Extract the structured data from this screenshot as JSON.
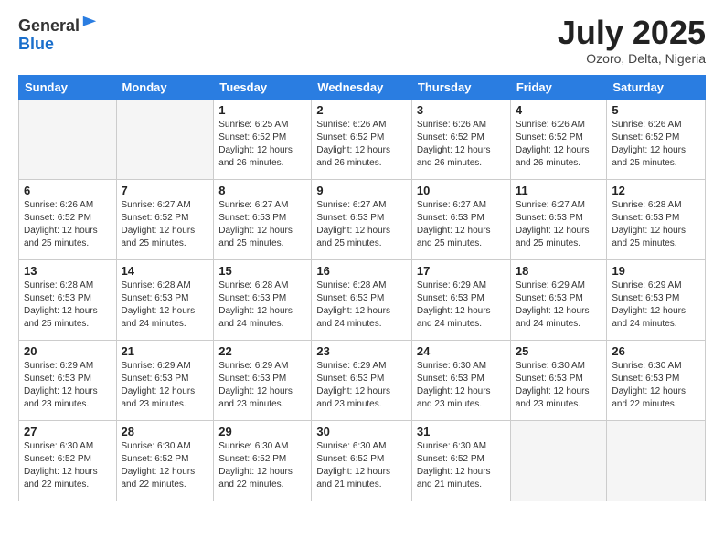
{
  "logo": {
    "general": "General",
    "blue": "Blue"
  },
  "title": "July 2025",
  "location": "Ozoro, Delta, Nigeria",
  "days_of_week": [
    "Sunday",
    "Monday",
    "Tuesday",
    "Wednesday",
    "Thursday",
    "Friday",
    "Saturday"
  ],
  "weeks": [
    [
      {
        "day": "",
        "info": ""
      },
      {
        "day": "",
        "info": ""
      },
      {
        "day": "1",
        "info": "Sunrise: 6:25 AM\nSunset: 6:52 PM\nDaylight: 12 hours and 26 minutes."
      },
      {
        "day": "2",
        "info": "Sunrise: 6:26 AM\nSunset: 6:52 PM\nDaylight: 12 hours and 26 minutes."
      },
      {
        "day": "3",
        "info": "Sunrise: 6:26 AM\nSunset: 6:52 PM\nDaylight: 12 hours and 26 minutes."
      },
      {
        "day": "4",
        "info": "Sunrise: 6:26 AM\nSunset: 6:52 PM\nDaylight: 12 hours and 26 minutes."
      },
      {
        "day": "5",
        "info": "Sunrise: 6:26 AM\nSunset: 6:52 PM\nDaylight: 12 hours and 25 minutes."
      }
    ],
    [
      {
        "day": "6",
        "info": "Sunrise: 6:26 AM\nSunset: 6:52 PM\nDaylight: 12 hours and 25 minutes."
      },
      {
        "day": "7",
        "info": "Sunrise: 6:27 AM\nSunset: 6:52 PM\nDaylight: 12 hours and 25 minutes."
      },
      {
        "day": "8",
        "info": "Sunrise: 6:27 AM\nSunset: 6:53 PM\nDaylight: 12 hours and 25 minutes."
      },
      {
        "day": "9",
        "info": "Sunrise: 6:27 AM\nSunset: 6:53 PM\nDaylight: 12 hours and 25 minutes."
      },
      {
        "day": "10",
        "info": "Sunrise: 6:27 AM\nSunset: 6:53 PM\nDaylight: 12 hours and 25 minutes."
      },
      {
        "day": "11",
        "info": "Sunrise: 6:27 AM\nSunset: 6:53 PM\nDaylight: 12 hours and 25 minutes."
      },
      {
        "day": "12",
        "info": "Sunrise: 6:28 AM\nSunset: 6:53 PM\nDaylight: 12 hours and 25 minutes."
      }
    ],
    [
      {
        "day": "13",
        "info": "Sunrise: 6:28 AM\nSunset: 6:53 PM\nDaylight: 12 hours and 25 minutes."
      },
      {
        "day": "14",
        "info": "Sunrise: 6:28 AM\nSunset: 6:53 PM\nDaylight: 12 hours and 24 minutes."
      },
      {
        "day": "15",
        "info": "Sunrise: 6:28 AM\nSunset: 6:53 PM\nDaylight: 12 hours and 24 minutes."
      },
      {
        "day": "16",
        "info": "Sunrise: 6:28 AM\nSunset: 6:53 PM\nDaylight: 12 hours and 24 minutes."
      },
      {
        "day": "17",
        "info": "Sunrise: 6:29 AM\nSunset: 6:53 PM\nDaylight: 12 hours and 24 minutes."
      },
      {
        "day": "18",
        "info": "Sunrise: 6:29 AM\nSunset: 6:53 PM\nDaylight: 12 hours and 24 minutes."
      },
      {
        "day": "19",
        "info": "Sunrise: 6:29 AM\nSunset: 6:53 PM\nDaylight: 12 hours and 24 minutes."
      }
    ],
    [
      {
        "day": "20",
        "info": "Sunrise: 6:29 AM\nSunset: 6:53 PM\nDaylight: 12 hours and 23 minutes."
      },
      {
        "day": "21",
        "info": "Sunrise: 6:29 AM\nSunset: 6:53 PM\nDaylight: 12 hours and 23 minutes."
      },
      {
        "day": "22",
        "info": "Sunrise: 6:29 AM\nSunset: 6:53 PM\nDaylight: 12 hours and 23 minutes."
      },
      {
        "day": "23",
        "info": "Sunrise: 6:29 AM\nSunset: 6:53 PM\nDaylight: 12 hours and 23 minutes."
      },
      {
        "day": "24",
        "info": "Sunrise: 6:30 AM\nSunset: 6:53 PM\nDaylight: 12 hours and 23 minutes."
      },
      {
        "day": "25",
        "info": "Sunrise: 6:30 AM\nSunset: 6:53 PM\nDaylight: 12 hours and 23 minutes."
      },
      {
        "day": "26",
        "info": "Sunrise: 6:30 AM\nSunset: 6:53 PM\nDaylight: 12 hours and 22 minutes."
      }
    ],
    [
      {
        "day": "27",
        "info": "Sunrise: 6:30 AM\nSunset: 6:52 PM\nDaylight: 12 hours and 22 minutes."
      },
      {
        "day": "28",
        "info": "Sunrise: 6:30 AM\nSunset: 6:52 PM\nDaylight: 12 hours and 22 minutes."
      },
      {
        "day": "29",
        "info": "Sunrise: 6:30 AM\nSunset: 6:52 PM\nDaylight: 12 hours and 22 minutes."
      },
      {
        "day": "30",
        "info": "Sunrise: 6:30 AM\nSunset: 6:52 PM\nDaylight: 12 hours and 21 minutes."
      },
      {
        "day": "31",
        "info": "Sunrise: 6:30 AM\nSunset: 6:52 PM\nDaylight: 12 hours and 21 minutes."
      },
      {
        "day": "",
        "info": ""
      },
      {
        "day": "",
        "info": ""
      }
    ]
  ]
}
